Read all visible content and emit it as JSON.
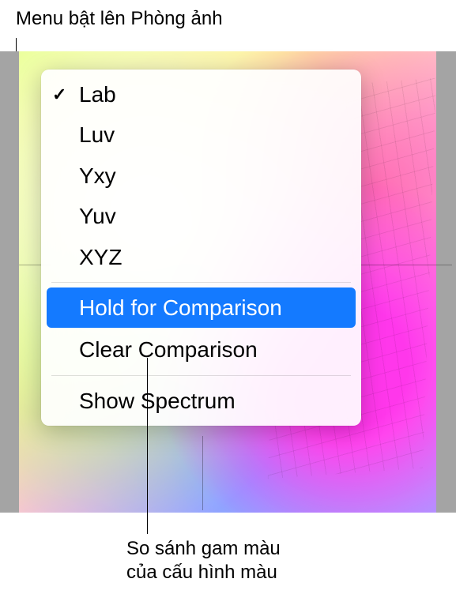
{
  "callouts": {
    "top": "Menu bật lên Phòng ảnh",
    "bottom_line1": "So sánh gam màu",
    "bottom_line2": "của cấu hình màu"
  },
  "menu": {
    "color_spaces": [
      {
        "label": "Lab",
        "checked": true
      },
      {
        "label": "Luv",
        "checked": false
      },
      {
        "label": "Yxy",
        "checked": false
      },
      {
        "label": "Yuv",
        "checked": false
      },
      {
        "label": "XYZ",
        "checked": false
      }
    ],
    "hold_comparison": "Hold for Comparison",
    "clear_comparison": "Clear Comparison",
    "show_spectrum": "Show Spectrum"
  }
}
